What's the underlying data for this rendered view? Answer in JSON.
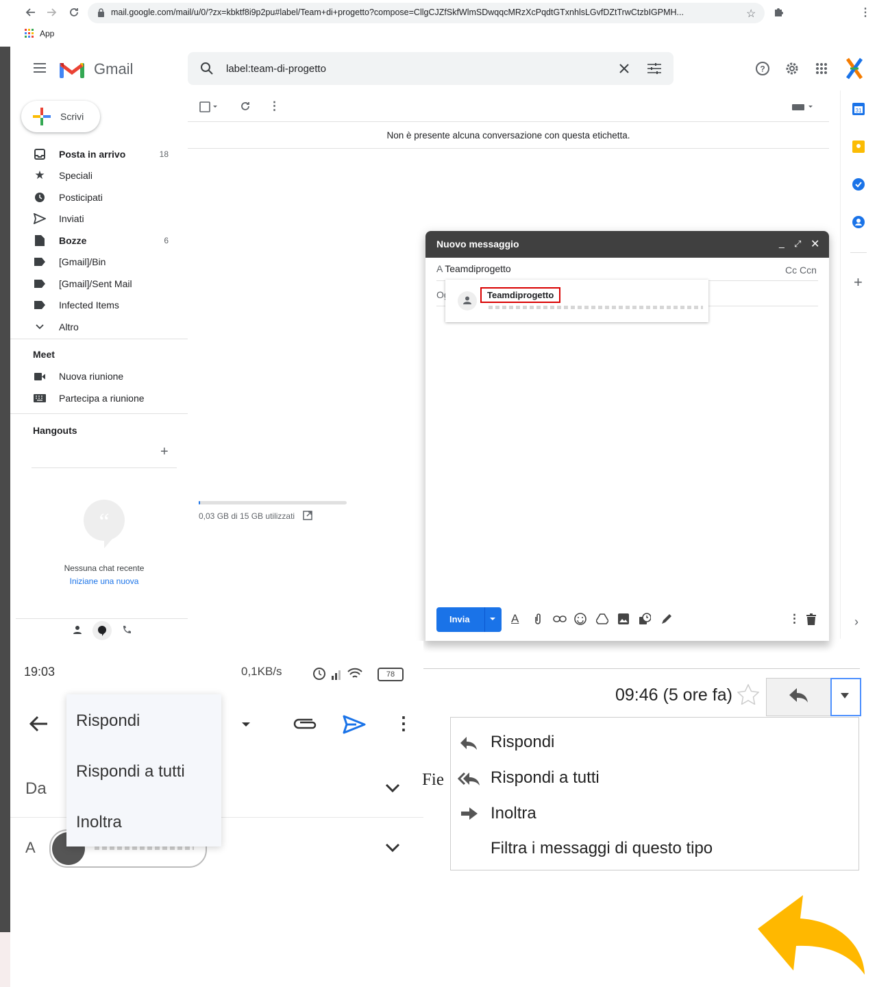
{
  "browser": {
    "url": "mail.google.com/mail/u/0/?zx=kbktf8i9p2pu#label/Team+di+progetto?compose=CllgCJZfSkfWlmSDwqqcMRzXcPqdtGTxnhlsLGvfDZtTrwCtzbIGPMH...",
    "apps_label": "App"
  },
  "gmail": {
    "title": "Gmail",
    "search_query": "label:team-di-progetto",
    "compose_label": "Scrivi"
  },
  "sidebar": {
    "items": [
      {
        "label": "Posta in arrivo",
        "count": "18",
        "icon": "inbox-icon",
        "bold": true
      },
      {
        "label": "Speciali",
        "count": "",
        "icon": "star-icon",
        "bold": false
      },
      {
        "label": "Posticipati",
        "count": "",
        "icon": "clock-icon",
        "bold": false
      },
      {
        "label": "Inviati",
        "count": "",
        "icon": "send-icon",
        "bold": false
      },
      {
        "label": "Bozze",
        "count": "6",
        "icon": "draft-icon",
        "bold": true
      },
      {
        "label": "[Gmail]/Bin",
        "count": "",
        "icon": "label-icon",
        "bold": false
      },
      {
        "label": "[Gmail]/Sent Mail",
        "count": "",
        "icon": "label-icon",
        "bold": false
      },
      {
        "label": "Infected Items",
        "count": "",
        "icon": "label-icon",
        "bold": false
      },
      {
        "label": "Altro",
        "count": "",
        "icon": "chevron-down-icon",
        "bold": false
      }
    ],
    "meet_title": "Meet",
    "meet_items": [
      {
        "label": "Nuova riunione",
        "icon": "video-icon"
      },
      {
        "label": "Partecipa a riunione",
        "icon": "keyboard-icon"
      }
    ],
    "hangouts_title": "Hangouts",
    "no_chat": "Nessuna chat recente",
    "start_new": "Iniziane una nuova"
  },
  "main": {
    "empty_message": "Non è presente alcuna conversazione con questa etichetta.",
    "storage": "0,03 GB di 15 GB utilizzati",
    "storage_fraction": 0.002
  },
  "compose": {
    "title": "Nuovo messaggio",
    "to_prefix": "A",
    "to_value": "Teamdiprogetto",
    "cc_label": "Cc Ccn",
    "subject_prefix": "Og",
    "suggestion_name": "Teamdiprogetto",
    "send_label": "Invia"
  },
  "mobile": {
    "time": "19:03",
    "status": "0,1KB/s",
    "battery": "78",
    "menu": [
      "Rispondi",
      "Rispondi a tutti",
      "Inoltra"
    ],
    "from_label": "Da",
    "to_label": "A"
  },
  "desktop_reply": {
    "time": "09:46 (5 ore fa)",
    "fie": "Fie",
    "menu": [
      {
        "label": "Rispondi",
        "icon": "reply-icon"
      },
      {
        "label": "Rispondi a tutti",
        "icon": "reply-all-icon"
      },
      {
        "label": "Inoltra",
        "icon": "forward-icon"
      },
      {
        "label": "Filtra i messaggi di questo tipo",
        "icon": ""
      }
    ]
  },
  "colors": {
    "accent_blue": "#1a73e8",
    "compose_header": "#404040",
    "highlight_red": "#d90000",
    "big_arrow": "#ffb800"
  }
}
